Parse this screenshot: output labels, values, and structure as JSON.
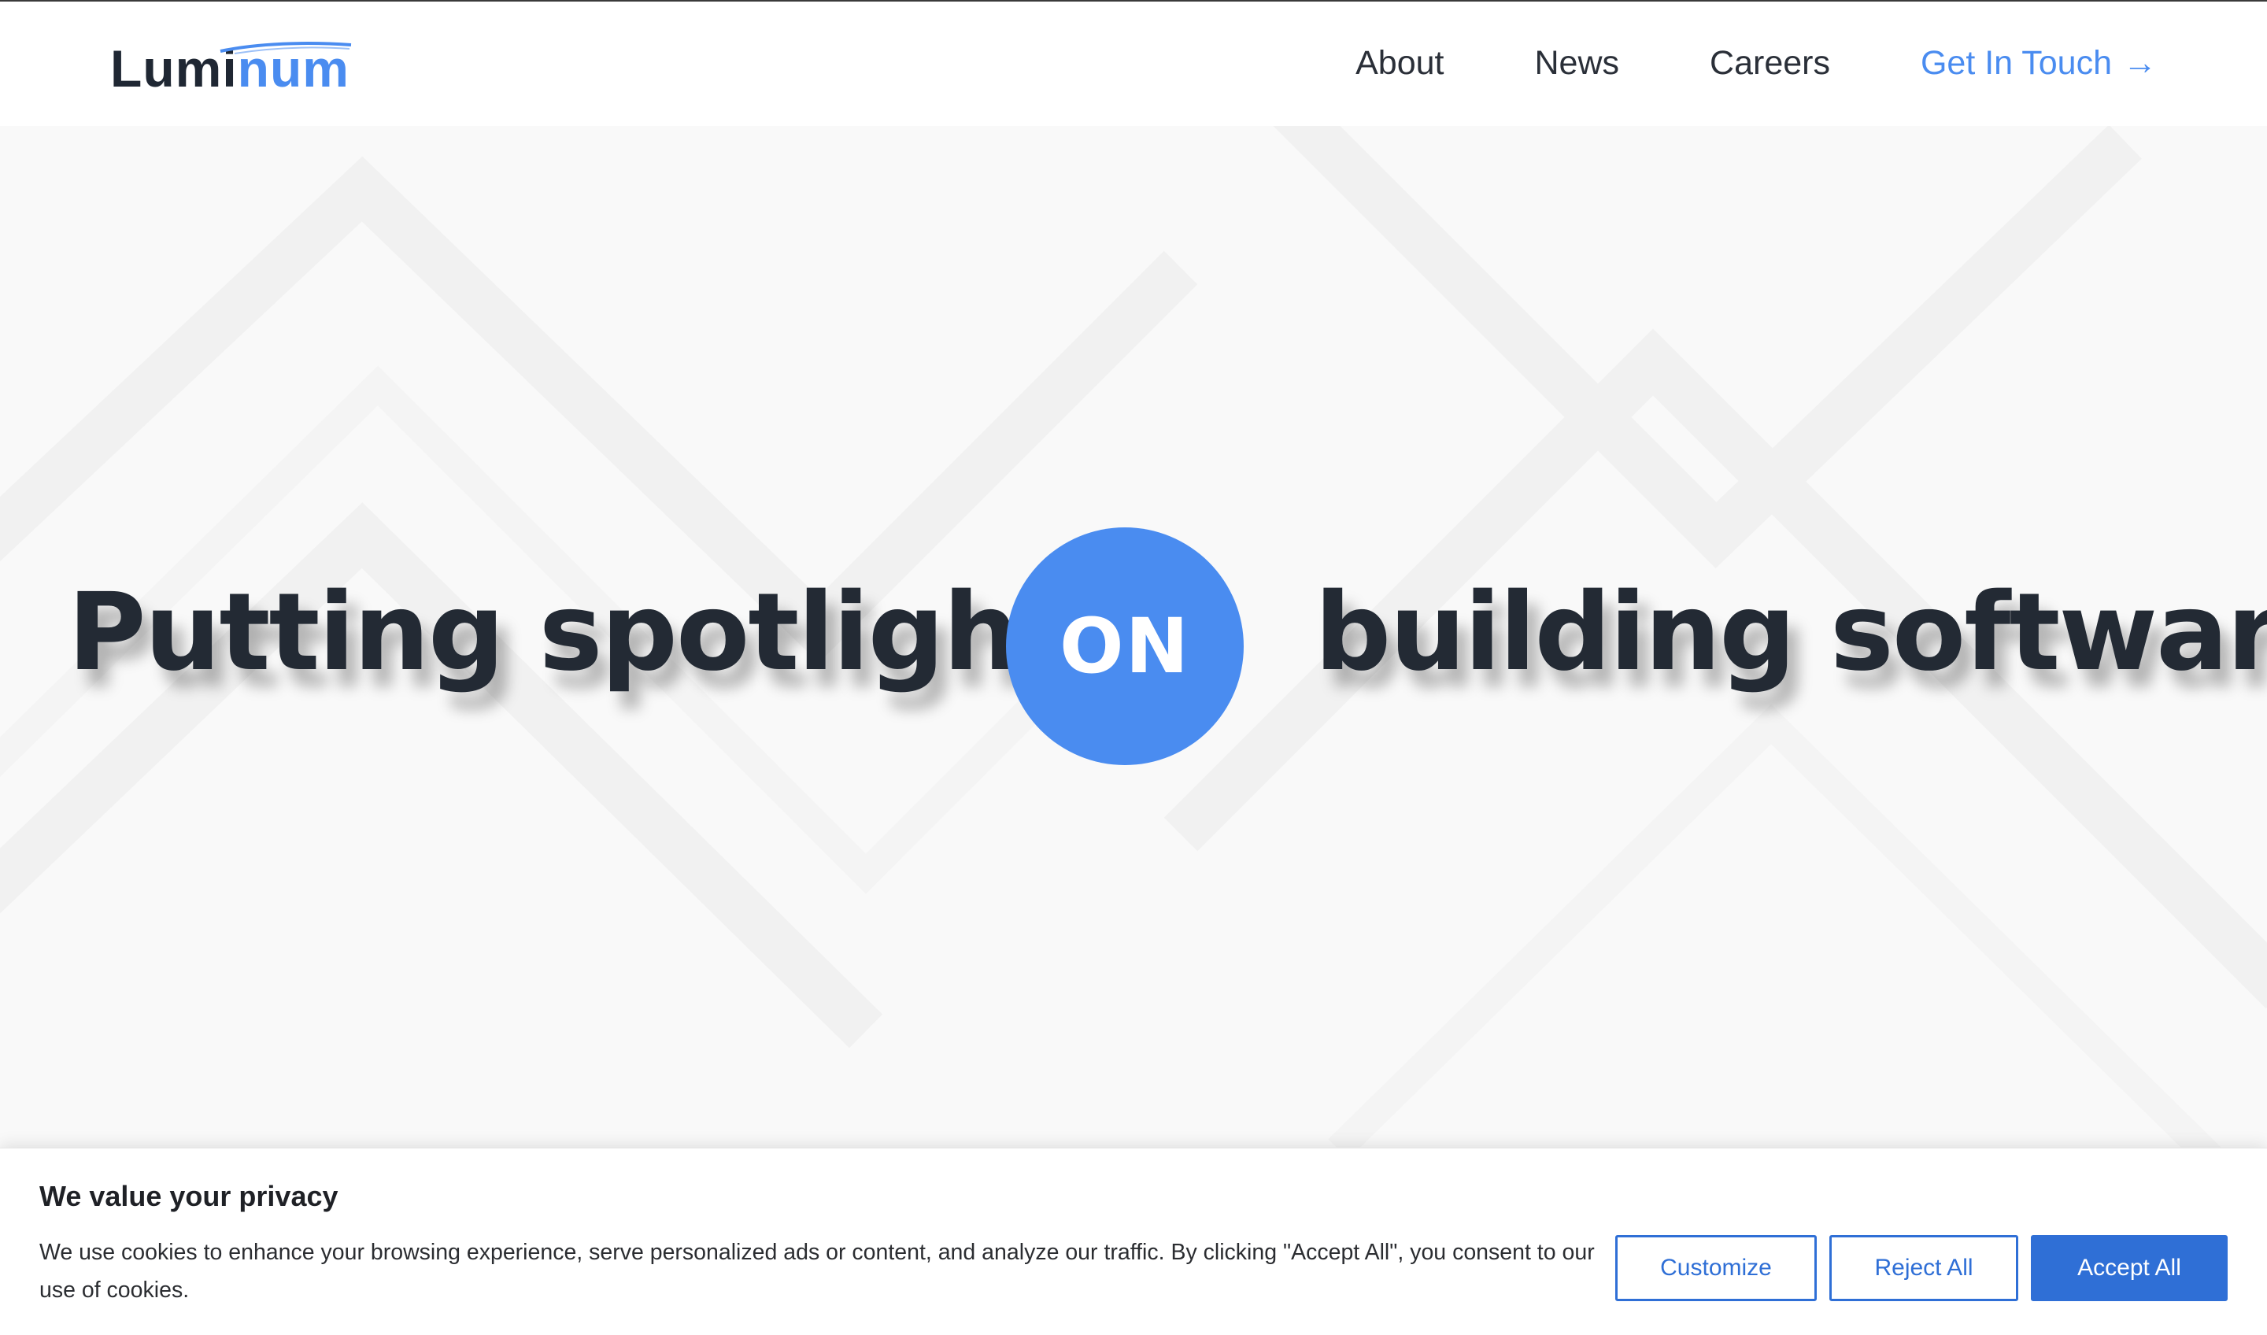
{
  "header": {
    "logo": {
      "dark_part": "Lumi",
      "blue_part": "num"
    },
    "nav": [
      {
        "label": "About"
      },
      {
        "label": "News"
      },
      {
        "label": "Careers"
      }
    ],
    "cta": {
      "label": "Get In Touch",
      "arrow": "→"
    }
  },
  "hero": {
    "left_text": "Putting spotlight",
    "circle_text": "ON",
    "right_text": "building software"
  },
  "cookie_banner": {
    "title": "We value your privacy",
    "body": "We use cookies to enhance your browsing experience, serve personalized ads or content, and analyze our traffic. By clicking \"Accept All\", you consent to our use of cookies.",
    "buttons": {
      "customize": "Customize",
      "reject": "Reject All",
      "accept": "Accept All"
    }
  },
  "colors": {
    "accent": "#4a8cf0",
    "button_blue": "#2f6fd6",
    "text_dark": "#232a34",
    "hero_bg": "#f9f9f9"
  },
  "icons": {
    "cta_arrow": "arrow-right-icon",
    "logo_swoosh": "logo-swoosh-icon"
  }
}
